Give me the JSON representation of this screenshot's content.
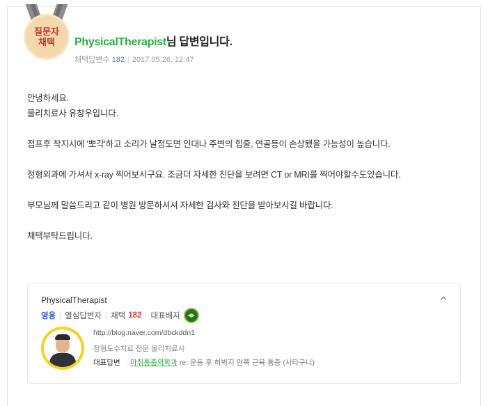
{
  "medal": {
    "line1": "질문자",
    "line2": "채택"
  },
  "answer": {
    "nickname": "PhysicalTherapist",
    "title_suffix": "님 답변입니다.",
    "meta_label": "채택답변수",
    "meta_count": "182",
    "date": "2017.05.26. 12:47"
  },
  "body": [
    "안녕하세요.",
    "물리치료사 유창우입니다.",
    "",
    "점프후 착지시에 '뽀각'하고 소리가 날정도면 인대나 주변의 힘줄, 연골등이 손상됐을 가능성이 높습니다.",
    "",
    "정형외과에 가셔서 x-ray 찍어보시구요. 조금더 자세한 진단을 보려면 CT or MRI를 찍어야할수도있습니다.",
    "",
    "부모님께 말씀드리고 같이 병원 방문하셔셔 자세한 검사와 진단을 받아보시길 바랍니다.",
    "",
    "채택부탁드립니다."
  ],
  "profile": {
    "name": "PhysicalTherapist",
    "rank": "영웅",
    "category": "열심답변자",
    "adopt_label": "채택",
    "adopt_count": "182",
    "badge_label": "대표배지",
    "blog_url": "http://blog.naver.com/dbckddn1",
    "intro": "정형도수치료 전문 물리치료사",
    "rep_label": "대표답변",
    "rep_dot": "·",
    "rep_link": "마취통증의학과",
    "rep_question": "re: 운동 후 허벅지 안쪽 근육 통증 (사타구니)"
  },
  "icons": {
    "collapse": "chevron-up-icon",
    "badge": "graduation-cap-icon"
  },
  "colors": {
    "nickname": "#2eab3a",
    "rank": "#2a60c9",
    "adopt_count": "#e03c3c",
    "medal_text": "#c0392b"
  }
}
